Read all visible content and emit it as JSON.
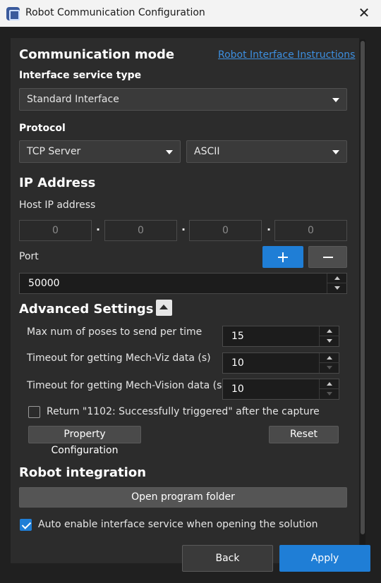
{
  "window": {
    "title": "Robot Communication Configuration",
    "close_glyph": "✕"
  },
  "communication": {
    "heading": "Communication mode",
    "instructions_link": "Robot Interface Instructions",
    "service_type_label": "Interface service type",
    "service_type_value": "Standard Interface",
    "protocol_label": "Protocol",
    "protocol_value": "TCP Server",
    "format_value": "ASCII"
  },
  "ip": {
    "heading": "IP Address",
    "host_label": "Host IP address",
    "octets": [
      "0",
      "0",
      "0",
      "0"
    ],
    "separator": "·",
    "port_label": "Port",
    "port_value": "50000"
  },
  "advanced": {
    "heading": "Advanced Settings",
    "max_poses_label": "Max num of poses to send per time",
    "max_poses_value": "15",
    "timeout_viz_label": "Timeout for getting Mech-Viz data (s)",
    "timeout_viz_value": "10",
    "timeout_vision_label": "Timeout for getting Mech-Vision data (s)",
    "timeout_vision_value": "10",
    "return_trigger_label": "Return \"1102: Successfully triggered\" after the capture",
    "return_trigger_checked": false,
    "property_config_label": "Property Configuration",
    "reset_label": "Reset"
  },
  "integration": {
    "heading": "Robot integration",
    "open_folder_label": "Open program folder",
    "auto_enable_label": "Auto enable interface service when opening the solution",
    "auto_enable_checked": true
  },
  "footer": {
    "back_label": "Back",
    "apply_label": "Apply"
  },
  "colors": {
    "accent": "#1f7ed6",
    "link": "#3d8fe0",
    "panel": "#2c2c2c",
    "background": "#202020"
  },
  "icons": {
    "app": "robot-app-icon",
    "close": "close-icon",
    "dropdown": "caret-down-icon",
    "add": "plus-icon",
    "remove": "minus-icon",
    "collapse": "caret-up-icon"
  }
}
